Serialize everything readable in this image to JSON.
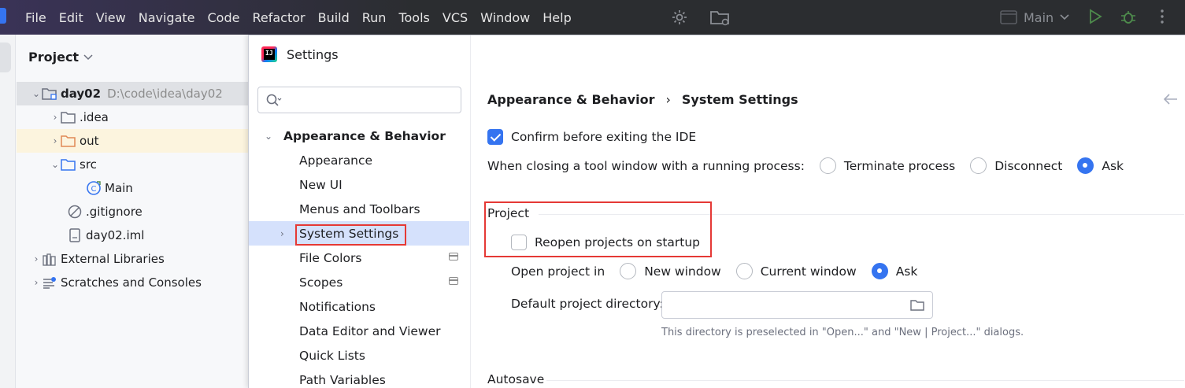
{
  "menubar": {
    "menus": [
      {
        "label": "File"
      },
      {
        "label": "Edit"
      },
      {
        "label": "View"
      },
      {
        "label": "Navigate"
      },
      {
        "label": "Code"
      },
      {
        "label": "Refactor"
      },
      {
        "label": "Build"
      },
      {
        "label": "Run"
      },
      {
        "label": "Tools"
      },
      {
        "label": "VCS"
      },
      {
        "label": "Window"
      },
      {
        "label": "Help"
      }
    ],
    "run_config": "Main"
  },
  "project_panel": {
    "title": "Project",
    "tree": [
      {
        "name": "day02",
        "path": "D:\\code\\idea\\day02"
      },
      {
        "name": ".idea"
      },
      {
        "name": "out"
      },
      {
        "name": "src"
      },
      {
        "name": "Main"
      },
      {
        "name": ".gitignore"
      },
      {
        "name": "day02.iml"
      },
      {
        "name": "External Libraries"
      },
      {
        "name": "Scratches and Consoles"
      }
    ]
  },
  "dialog": {
    "title": "Settings",
    "search_placeholder": "",
    "nav": {
      "group": "Appearance & Behavior",
      "items": [
        {
          "label": "Appearance"
        },
        {
          "label": "New UI"
        },
        {
          "label": "Menus and Toolbars"
        },
        {
          "label": "System Settings"
        },
        {
          "label": "File Colors"
        },
        {
          "label": "Scopes"
        },
        {
          "label": "Notifications"
        },
        {
          "label": "Data Editor and Viewer"
        },
        {
          "label": "Quick Lists"
        },
        {
          "label": "Path Variables"
        }
      ]
    },
    "breadcrumb": {
      "parent": "Appearance & Behavior",
      "separator": "›",
      "current": "System Settings"
    },
    "confirm_exit": {
      "label": "Confirm before exiting the IDE",
      "checked": true
    },
    "closing_tool_window": {
      "label": "When closing a tool window with a running process:",
      "options": [
        "Terminate process",
        "Disconnect",
        "Ask"
      ],
      "selected": "Ask"
    },
    "project_section": {
      "title": "Project",
      "reopen": {
        "label": "Reopen projects on startup",
        "checked": false
      },
      "open_in": {
        "label": "Open project in",
        "options": [
          "New window",
          "Current window",
          "Ask"
        ],
        "selected": "Ask"
      },
      "default_dir": {
        "label": "Default project directory:",
        "value": ""
      },
      "hint": "This directory is preselected in \"Open...\" and \"New | Project...\" dialogs."
    },
    "autosave_title": "Autosave"
  },
  "colors": {
    "accent": "#3574f0",
    "highlight_box": "#e53935",
    "selection": "#d5e1fc"
  }
}
